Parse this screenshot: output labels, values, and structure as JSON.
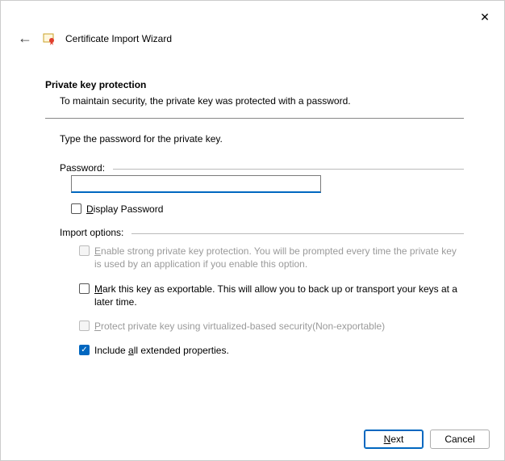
{
  "window": {
    "title": "Certificate Import Wizard"
  },
  "section": {
    "title": "Private key protection",
    "description": "To maintain security, the private key was protected with a password.",
    "instruction": "Type the password for the private key."
  },
  "password": {
    "group_label": "Password:",
    "value": "",
    "display_label": "Display Password",
    "display_accel": "D"
  },
  "import": {
    "group_label": "Import options:",
    "opts": [
      {
        "text": "Enable strong private key protection. You will be prompted every time the private key is used by an application if you enable this option.",
        "accel": "E",
        "checked": false,
        "disabled": true
      },
      {
        "text": "Mark this key as exportable. This will allow you to back up or transport your keys at a later time.",
        "accel": "M",
        "checked": false,
        "disabled": false
      },
      {
        "text": "Protect private key using virtualized-based security(Non-exportable)",
        "accel": "P",
        "checked": false,
        "disabled": true
      },
      {
        "text": "Include all extended properties.",
        "accel": "a",
        "checked": true,
        "disabled": false
      }
    ]
  },
  "buttons": {
    "next": "Next",
    "next_accel": "N",
    "cancel": "Cancel"
  }
}
